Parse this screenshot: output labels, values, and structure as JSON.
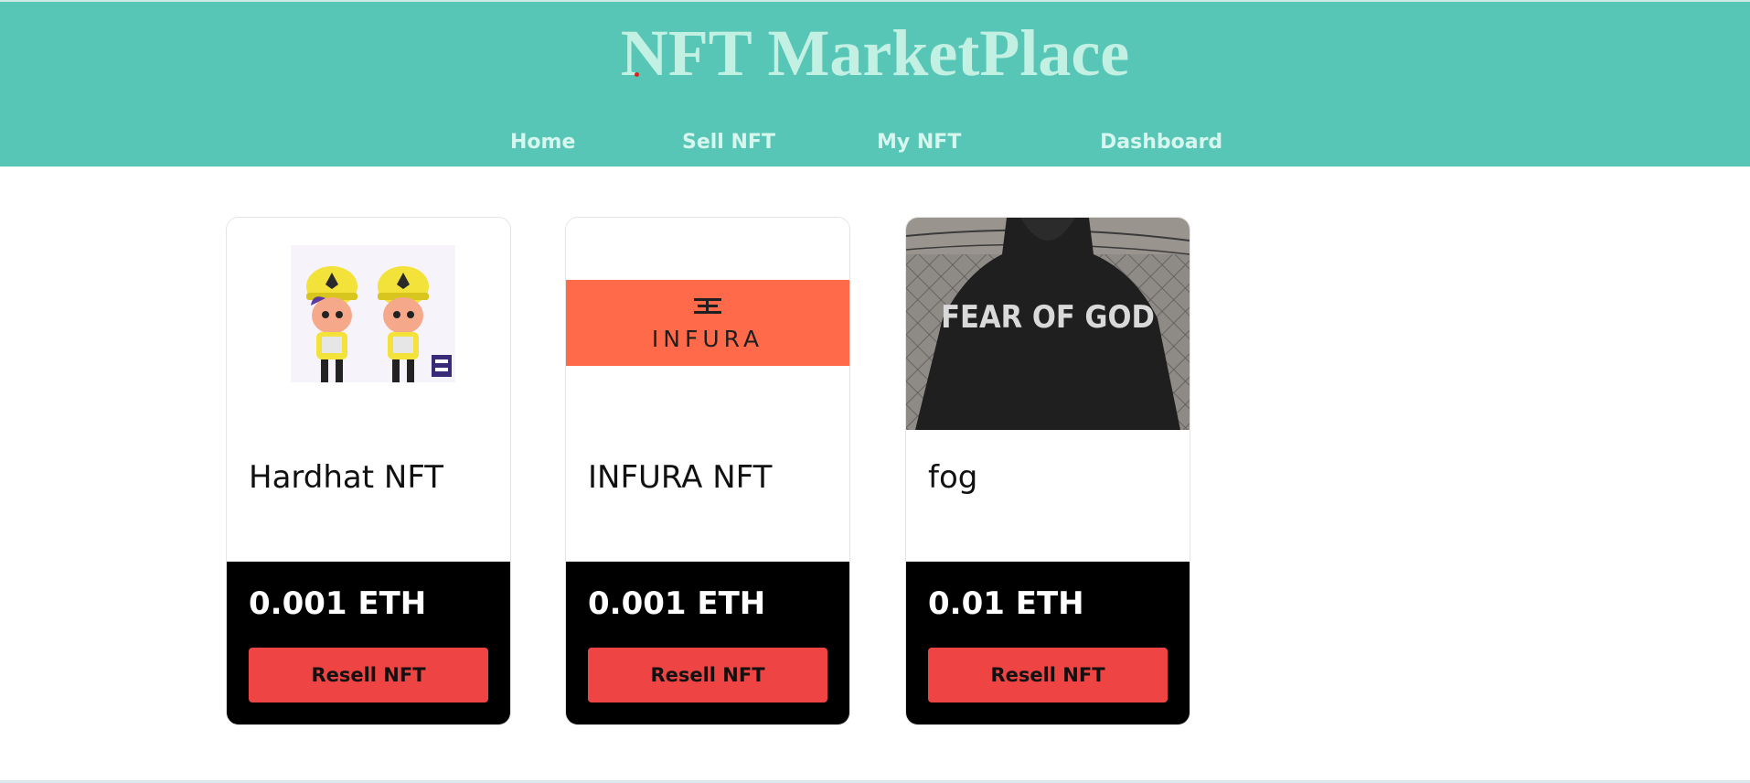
{
  "header": {
    "title": "NFT MarketPlace",
    "nav": [
      {
        "label": "Home"
      },
      {
        "label": "Sell NFT"
      },
      {
        "label": "My NFT"
      },
      {
        "label": "Dashboard"
      }
    ]
  },
  "nfts": [
    {
      "name": "Hardhat NFT",
      "price": "0.001 ETH",
      "action": "Resell NFT",
      "image_icon": "hardhat-workers-icon"
    },
    {
      "name": "INFURA NFT",
      "price": "0.001 ETH",
      "action": "Resell NFT",
      "image_icon": "infura-logo-icon",
      "image_text": "INFURA"
    },
    {
      "name": "fog",
      "price": "0.01 ETH",
      "action": "Resell NFT",
      "image_icon": "fear-of-god-hoodie-icon",
      "image_text": "FEAR OF GOD"
    }
  ],
  "colors": {
    "header_bg": "#58c6b6",
    "title": "#c2f0e3",
    "button": "#ef4444",
    "footer_bg": "#000000"
  }
}
